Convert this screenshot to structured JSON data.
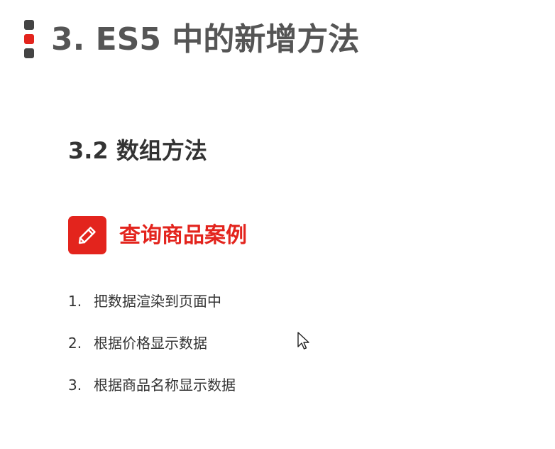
{
  "colors": {
    "accent_red": "#e3241d",
    "bar_gray": "#444444",
    "title_gray": "#555555",
    "text_dark": "#333333"
  },
  "header": {
    "title": "3. ES5 中的新增方法"
  },
  "section": {
    "title": "3.2 数组方法"
  },
  "case": {
    "icon": "pencil-icon",
    "title": "查询商品案例"
  },
  "steps": [
    {
      "num": "1.",
      "text": "把数据渲染到页面中"
    },
    {
      "num": "2.",
      "text": "根据价格显示数据"
    },
    {
      "num": "3.",
      "text": "根据商品名称显示数据"
    }
  ]
}
